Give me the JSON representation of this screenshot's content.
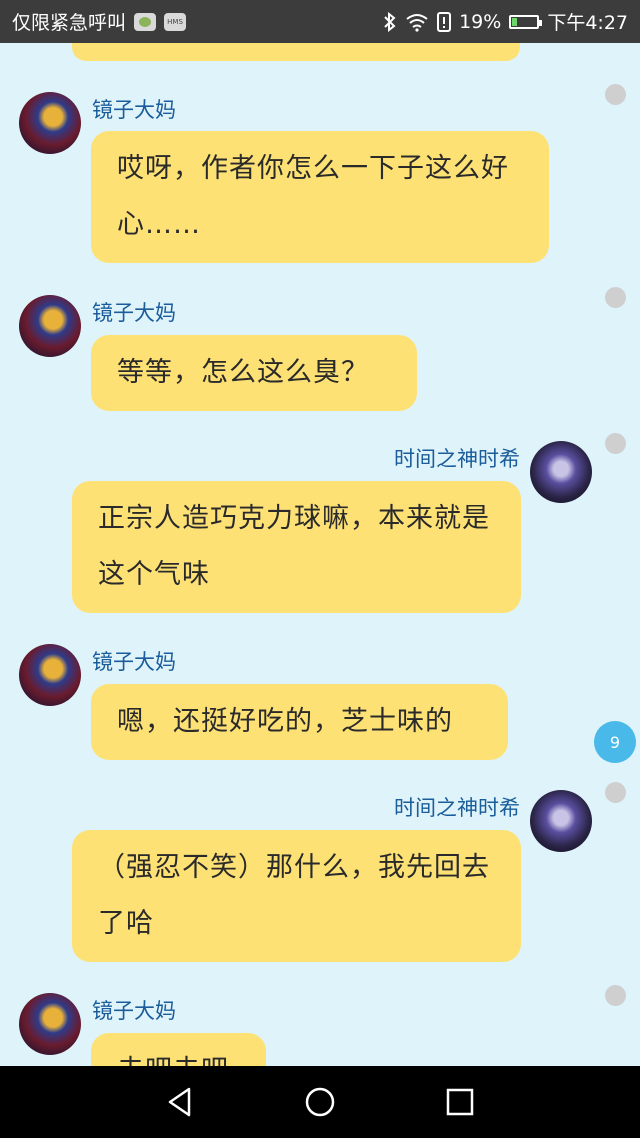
{
  "status_bar": {
    "carrier": "仅限紧急呼叫",
    "battery_percent": "19%",
    "battery_level": 0.19,
    "time": "下午4:27",
    "hms_label": "HMS"
  },
  "chat": {
    "unread_count": "9",
    "messages": [
      {
        "sender": "镜子大妈",
        "side": "left",
        "text": "哎呀，作者你怎么一下子这么好心……"
      },
      {
        "sender": "镜子大妈",
        "side": "left",
        "text": "等等，怎么这么臭？"
      },
      {
        "sender": "时间之神时希",
        "side": "right",
        "text": "正宗人造巧克力球嘛，本来就是这个气味"
      },
      {
        "sender": "镜子大妈",
        "side": "left",
        "text": "嗯，还挺好吃的，芝士味的"
      },
      {
        "sender": "时间之神时希",
        "side": "right",
        "text": "（强忍不笑）那什么，我先回去了哈"
      },
      {
        "sender": "镜子大妈",
        "side": "left",
        "text": "去吧去吧"
      }
    ]
  },
  "colors": {
    "background": "#dff3fb",
    "bubble": "#fde175",
    "name": "#1a5d9a",
    "badge": "#48b9e8"
  }
}
